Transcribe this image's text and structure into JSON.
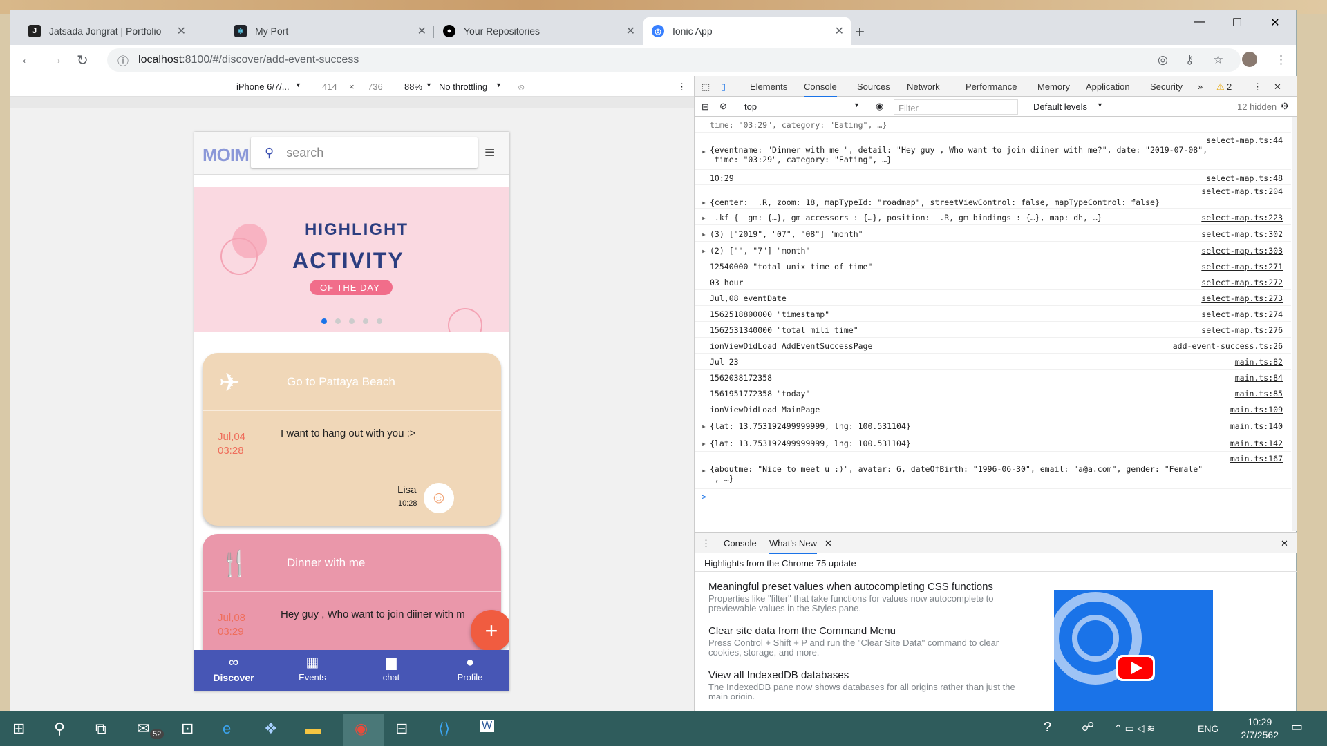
{
  "browser": {
    "tabs": [
      {
        "title": "Jatsada Jongrat | Portfolio",
        "icon": "portfolio-j-icon"
      },
      {
        "title": "My Port",
        "icon": "react-icon"
      },
      {
        "title": "Your Repositories",
        "icon": "github-icon"
      },
      {
        "title": "Ionic App",
        "icon": "ionic-icon",
        "active": true
      }
    ],
    "url_host": "localhost",
    "url_path": ":8100/#/discover/add-event-success"
  },
  "device_toolbar": {
    "device": "iPhone 6/7/...",
    "width": "414",
    "height": "736",
    "times": "×",
    "zoom": "88%",
    "throttle": "No throttling"
  },
  "app": {
    "logo": "MOIM",
    "search_placeholder": "search",
    "banner": {
      "line1": "HIGHLIGHT",
      "line2": "ACTIVITY",
      "line3": "OF THE DAY"
    },
    "cards": [
      {
        "title": "Go to Pattaya Beach",
        "date": "Jul,04",
        "time": "03:28",
        "detail": "I want to hang out with you :>",
        "user": "Lisa",
        "user_time": "10:28",
        "color": "#f0d7b8"
      },
      {
        "title": "Dinner with me",
        "date": "Jul,08",
        "time": "03:29",
        "detail": "Hey guy , Who want to join diiner with m",
        "color": "#ea97aa"
      }
    ],
    "fab": "+",
    "tabs": [
      {
        "label": "Discover",
        "icon": "infinity-icon"
      },
      {
        "label": "Events",
        "icon": "calendar-icon"
      },
      {
        "label": "chat",
        "icon": "chat-icon"
      },
      {
        "label": "Profile",
        "icon": "person-icon"
      }
    ]
  },
  "devtools": {
    "tabs": [
      "Elements",
      "Console",
      "Sources",
      "Network",
      "Performance",
      "Memory",
      "Application",
      "Security"
    ],
    "warnings": "2",
    "context": "top",
    "filter_placeholder": "Filter",
    "levels": "Default levels",
    "hidden": "12 hidden",
    "console_rows": [
      {
        "msg": "time: \"03:29\", category: \"Eating\", …}",
        "src": ""
      },
      {
        "msg": "{eventname: \"Dinner with me \", detail: \"Hey guy , Who want to join diiner with me?\", date: \"2019-07-08\",\n time: \"03:29\", category: \"Eating\", …}",
        "src": "select-map.ts:44"
      },
      {
        "msg": "10:29",
        "src": "select-map.ts:48"
      },
      {
        "msg": "{center: _.R, zoom: 18, mapTypeId: \"roadmap\", streetViewControl: false, mapTypeControl: false}",
        "src": "select-map.ts:204"
      },
      {
        "msg": "_.kf {__gm: {…}, gm_accessors_: {…}, position: _.R, gm_bindings_: {…}, map: dh, …}",
        "src": "select-map.ts:223"
      },
      {
        "msg": "(3) [\"2019\", \"07\", \"08\"] \"month\"",
        "src": "select-map.ts:302"
      },
      {
        "msg": "(2) [\"\", \"7\"] \"month\"",
        "src": "select-map.ts:303"
      },
      {
        "msg": "12540000 \"total unix time of time\"",
        "src": "select-map.ts:271"
      },
      {
        "msg": "03 hour",
        "src": "select-map.ts:272"
      },
      {
        "msg": "Jul,08 eventDate",
        "src": "select-map.ts:273"
      },
      {
        "msg": "1562518800000 \"timestamp\"",
        "src": "select-map.ts:274"
      },
      {
        "msg": "1562531340000 \"total mili time\"",
        "src": "select-map.ts:276"
      },
      {
        "msg": "ionViewDidLoad AddEventSuccessPage",
        "src": "add-event-success.ts:26"
      },
      {
        "msg": "Jul 23",
        "src": "main.ts:82"
      },
      {
        "msg": "1562038172358",
        "src": "main.ts:84"
      },
      {
        "msg": "1561951772358 \"today\"",
        "src": "main.ts:85"
      },
      {
        "msg": "ionViewDidLoad MainPage",
        "src": "main.ts:109"
      },
      {
        "msg": "{lat: 13.753192499999999, lng: 100.531104}",
        "src": "main.ts:140"
      },
      {
        "msg": "{lat: 13.753192499999999, lng: 100.531104}",
        "src": "main.ts:142"
      },
      {
        "msg": "{aboutme: \"Nice to meet u :)\", avatar: 6, dateOfBirth: \"1996-06-30\", email: \"a@a.com\", gender: \"Female\"\n , …}",
        "src": "main.ts:167"
      }
    ],
    "prompt": ">",
    "drawer": {
      "tabs": [
        "Console",
        "What's New"
      ],
      "subtitle": "Highlights from the Chrome 75 update",
      "items": [
        {
          "h": "Meaningful preset values when autocompleting CSS functions",
          "p": "Properties like \"filter\" that take functions for values now autocomplete to previewable values in the Styles pane."
        },
        {
          "h": "Clear site data from the Command Menu",
          "p": "Press Control + Shift + P and run the \"Clear Site Data\" command to clear cookies, storage, and more."
        },
        {
          "h": "View all IndexedDB databases",
          "p": "The IndexedDB pane now shows databases for all origins rather than just the main origin."
        }
      ]
    }
  },
  "taskbar": {
    "mail_badge": "52",
    "lang": "ENG",
    "time": "10:29",
    "date": "2/7/2562"
  }
}
